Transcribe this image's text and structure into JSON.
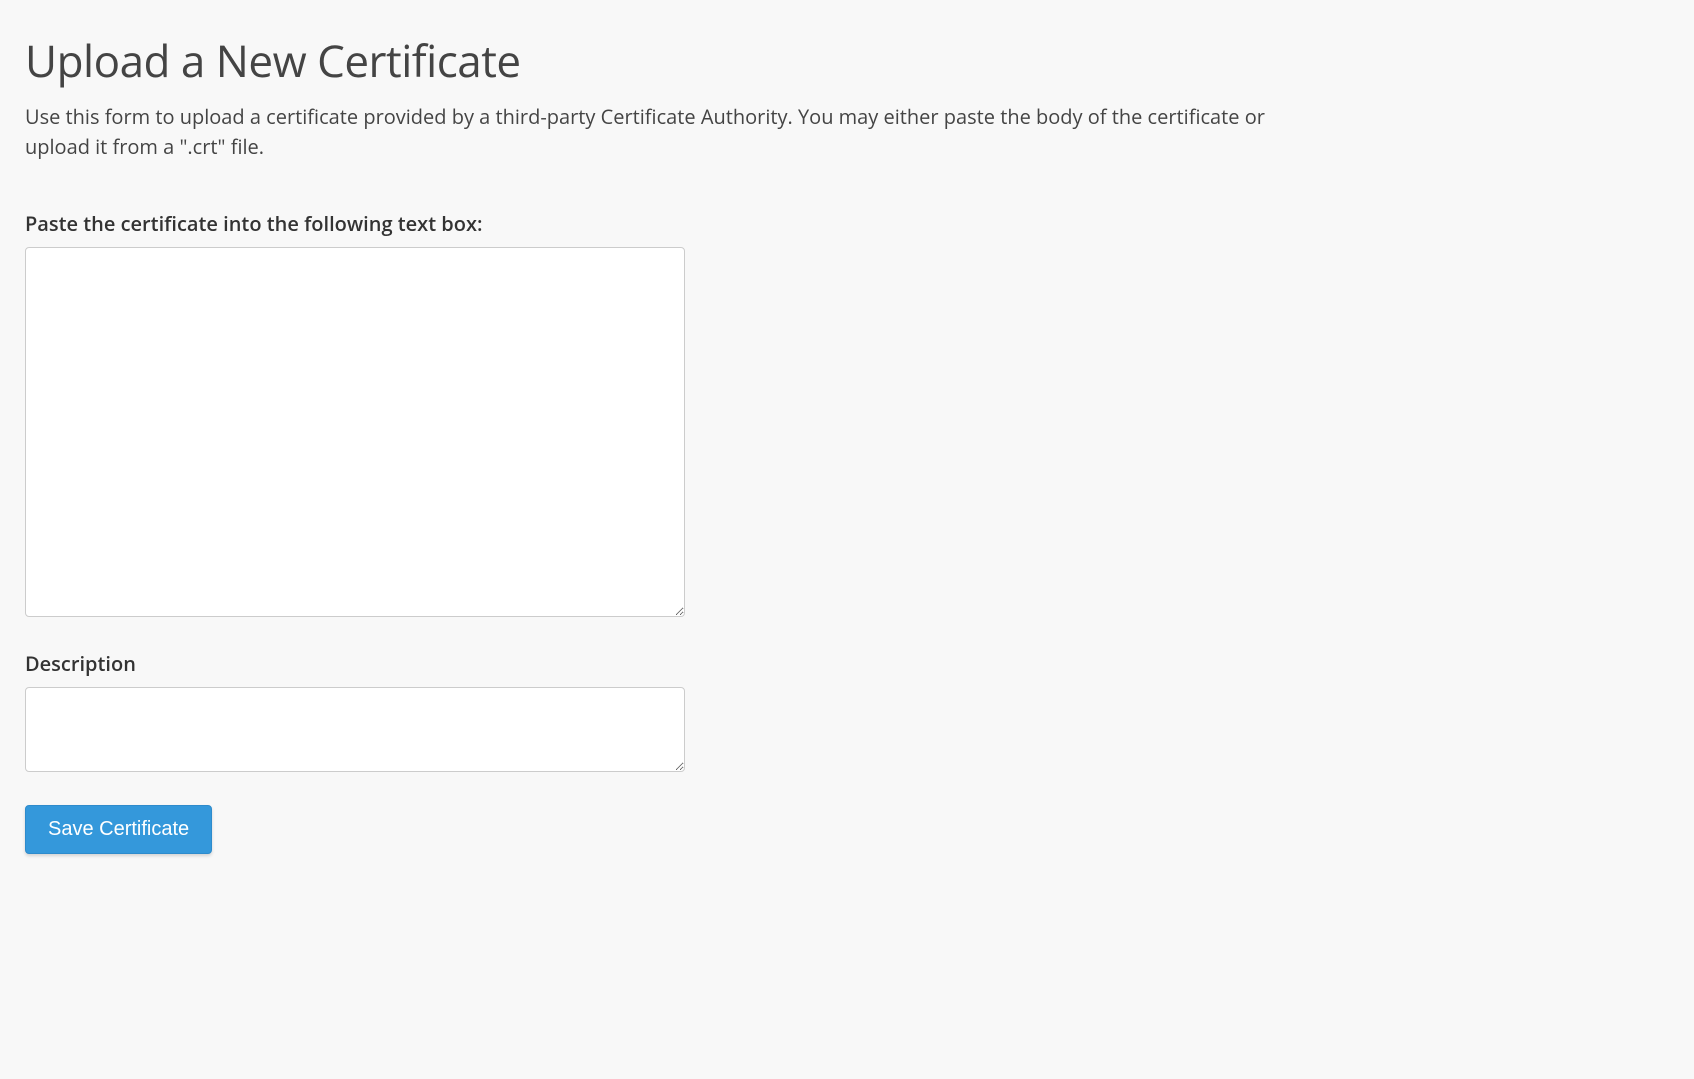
{
  "header": {
    "title": "Upload a New Certificate",
    "description": "Use this form to upload a certificate provided by a third-party Certificate Authority. You may either paste the body of the certificate or upload it from a \".crt\" file."
  },
  "form": {
    "certificate_label": "Paste the certificate into the following text box:",
    "certificate_value": "",
    "description_label": "Description",
    "description_value": "",
    "save_button_label": "Save Certificate"
  }
}
